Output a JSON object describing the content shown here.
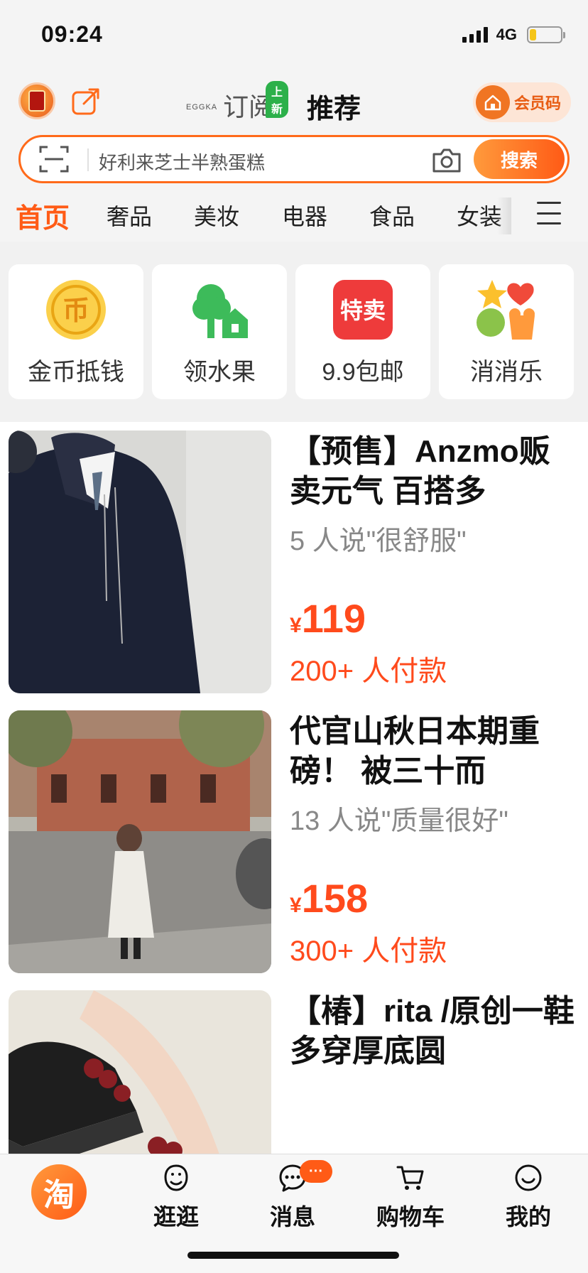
{
  "status_bar": {
    "time": "09:24",
    "network": "4G",
    "battery_level": 0.22
  },
  "header": {
    "brand_small": "EGGKA",
    "tab_subscribe": "订阅",
    "new_badge": "上新",
    "tab_recommend": "推荐",
    "member_label": "会员码",
    "share_icon": "share-out-icon"
  },
  "search": {
    "placeholder": "好利来芝士半熟蛋糕",
    "button_label": "搜索",
    "scan_icon": "scan-icon",
    "camera_icon": "camera-icon"
  },
  "categories": [
    "首页",
    "奢品",
    "美妆",
    "电器",
    "食品",
    "女装"
  ],
  "tiles": [
    {
      "label": "金币抵钱",
      "icon": "gold-coin-icon"
    },
    {
      "label": "领水果",
      "icon": "tree-icon"
    },
    {
      "label": "9.9包邮",
      "icon": "special-sale-icon"
    },
    {
      "label": "消消乐",
      "icon": "match-game-icon"
    }
  ],
  "products": [
    {
      "title": "【预售】Anzmo贩卖元气 百搭多",
      "review": "5 人说\"很舒服\"",
      "price_symbol": "¥",
      "price": "119",
      "sales": "200+ 人付款"
    },
    {
      "title": "代官山秋日本期重磅！ 被三十而",
      "review": "13 人说\"质量很好\"",
      "price_symbol": "¥",
      "price": "158",
      "sales": "300+ 人付款"
    },
    {
      "title": "【椿】rita /原创一鞋多穿厚底圆",
      "review": "",
      "price_symbol": "",
      "price": "",
      "sales": ""
    }
  ],
  "bottom_nav": {
    "home_glyph": "淘",
    "items": [
      {
        "label": "逛逛",
        "icon": "stroll-icon"
      },
      {
        "label": "消息",
        "icon": "message-icon",
        "badge": "···"
      },
      {
        "label": "购物车",
        "icon": "cart-icon"
      },
      {
        "label": "我的",
        "icon": "profile-icon"
      }
    ]
  },
  "colors": {
    "accent": "#ff5b16",
    "price": "#ff4a1c",
    "new_badge": "#2cb04a"
  }
}
